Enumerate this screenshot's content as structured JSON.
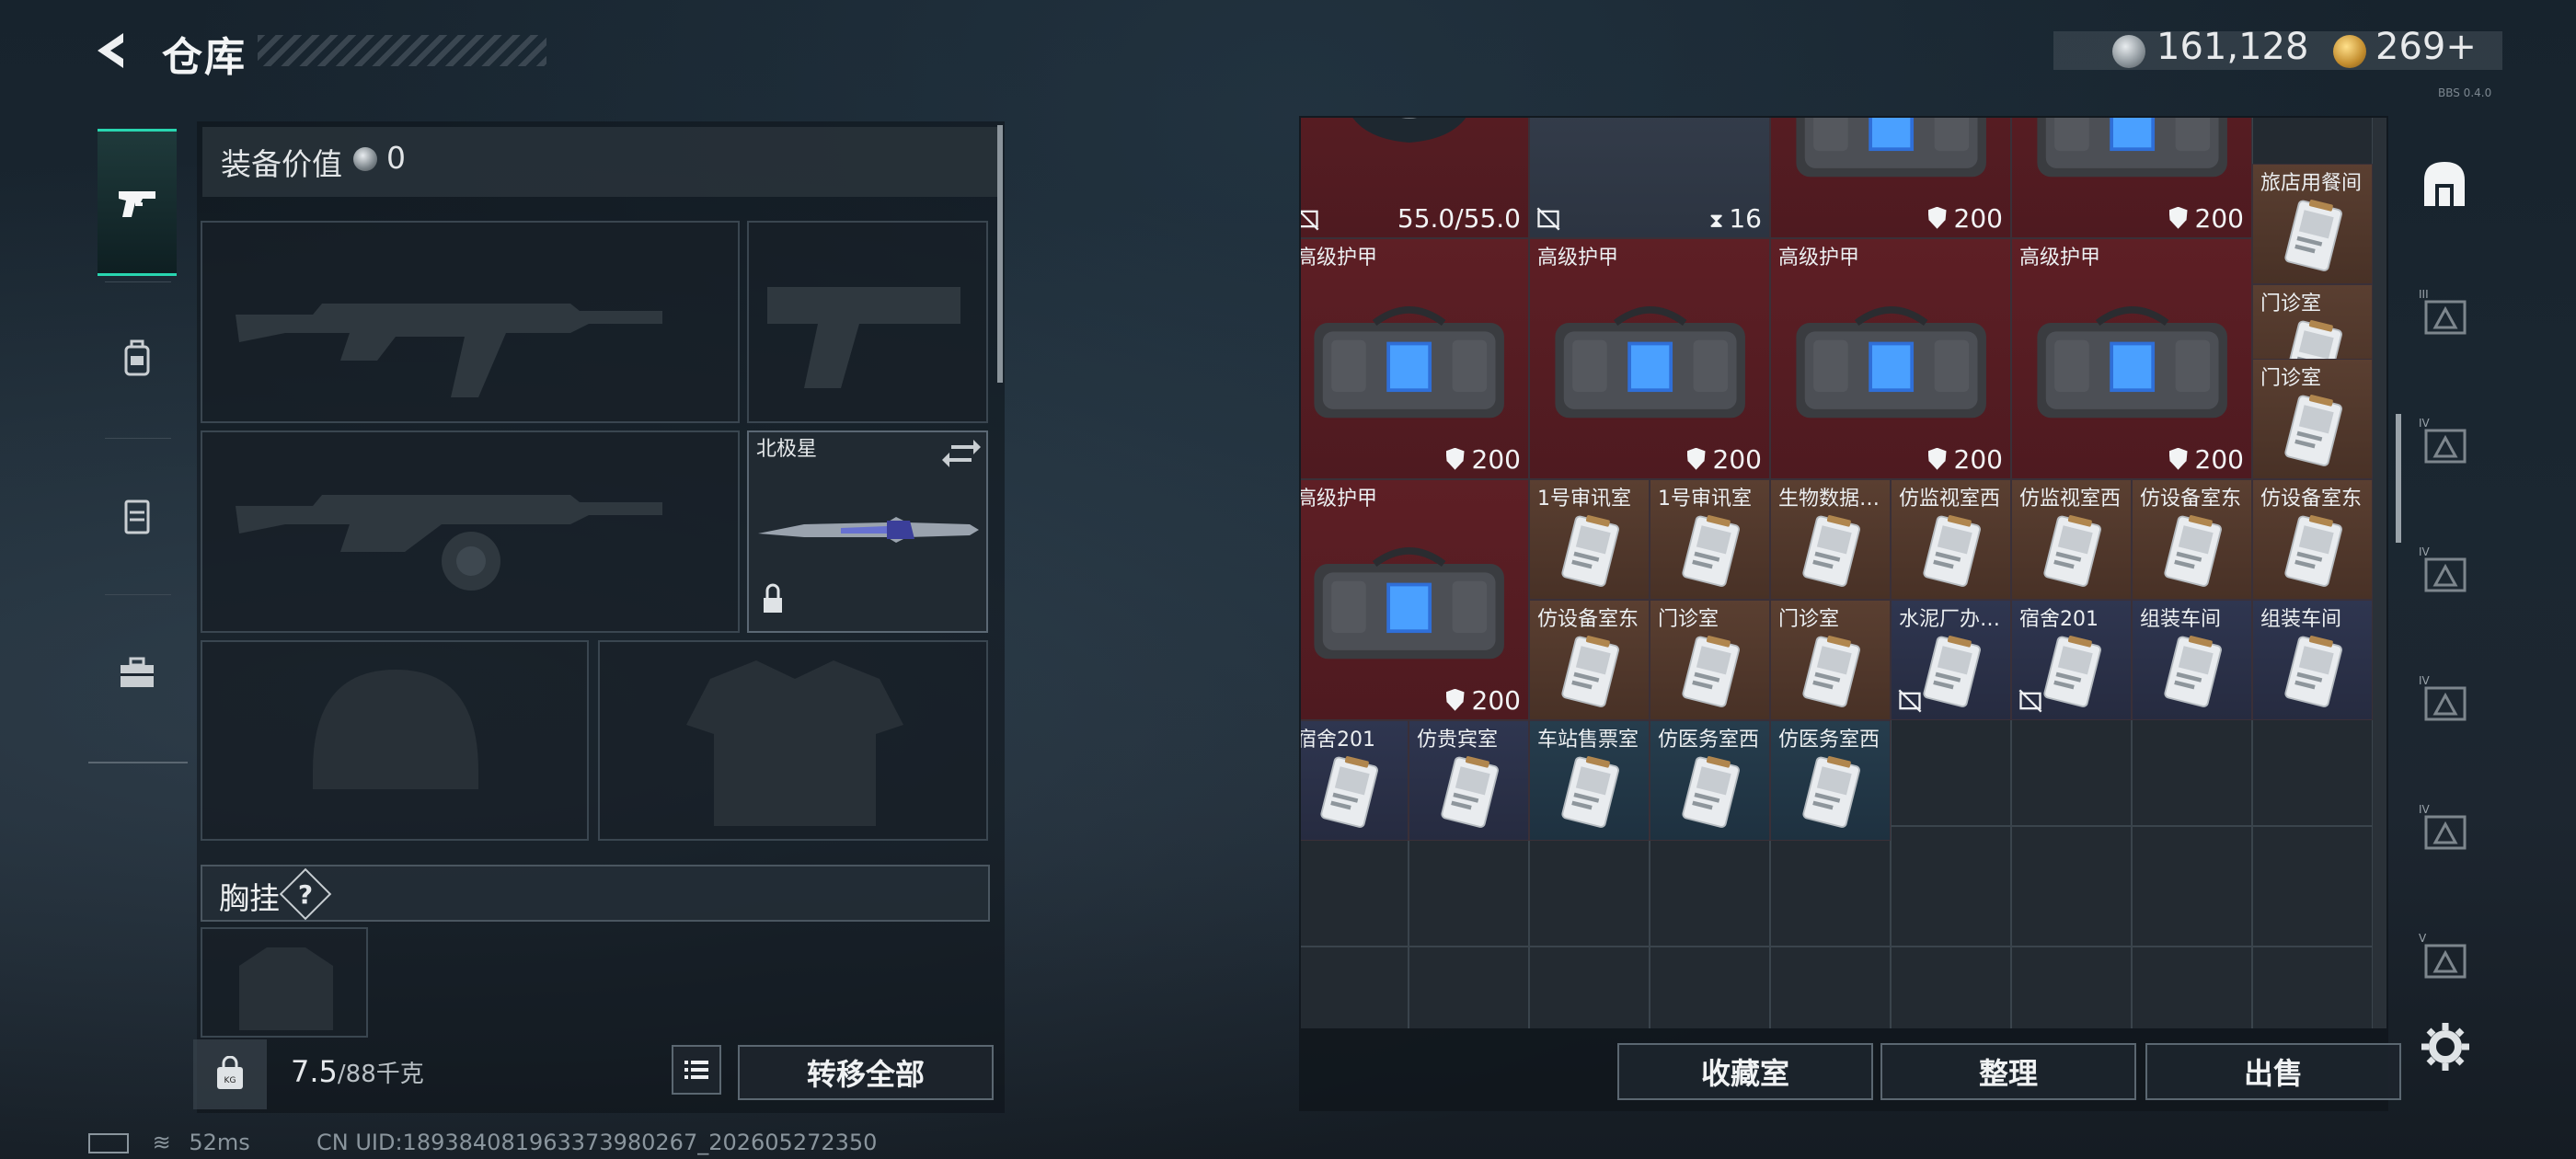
{
  "header": {
    "title": "仓库",
    "currency": {
      "silver": "161,128",
      "gold": "269+"
    },
    "version": "BBS 0.4.0"
  },
  "sidebar": {
    "tabs": [
      "gun-icon",
      "backpack-icon",
      "vest-icon",
      "toolbox-icon"
    ],
    "active": 0,
    "accent": "#28d6b0"
  },
  "loadout": {
    "value_label": "装备价值",
    "value": "0",
    "melee_name": "北极星",
    "rig_label": "胸挂",
    "rig_help": "?",
    "weight_current": "7.5",
    "weight_max": "/88千克",
    "transfer_all": "转移全部"
  },
  "storage": {
    "items": [
      {
        "name": "",
        "value": "55.0/55.0",
        "color": "red",
        "kind": "helmet",
        "noswap": true
      },
      {
        "name": "",
        "value": "16",
        "color": "gray",
        "kind": "pack",
        "noswap": true
      },
      {
        "name": "",
        "value": "200",
        "color": "red",
        "kind": "bag"
      },
      {
        "name": "",
        "value": "200",
        "color": "red",
        "kind": "bag"
      },
      {
        "name": "旅店用餐间",
        "value": "",
        "color": "brown",
        "kind": "card"
      },
      {
        "name": "高级护甲",
        "value": "200",
        "color": "red",
        "kind": "bag"
      },
      {
        "name": "高级护甲",
        "value": "200",
        "color": "red",
        "kind": "bag"
      },
      {
        "name": "高级护甲",
        "value": "200",
        "color": "red",
        "kind": "bag"
      },
      {
        "name": "高级护甲",
        "value": "200",
        "color": "red",
        "kind": "bag"
      },
      {
        "name": "门诊室",
        "value": "",
        "color": "brown",
        "kind": "card",
        "noswap": true
      },
      {
        "name": "门诊室",
        "value": "",
        "color": "brown",
        "kind": "card"
      },
      {
        "name": "高级护甲",
        "value": "200",
        "color": "red",
        "kind": "bag"
      },
      {
        "name": "1号审讯室",
        "value": "",
        "color": "brown",
        "kind": "card"
      },
      {
        "name": "1号审讯室",
        "value": "",
        "color": "brown",
        "kind": "card"
      },
      {
        "name": "生物数据…",
        "value": "",
        "color": "brown",
        "kind": "card"
      },
      {
        "name": "仿监视室西",
        "value": "",
        "color": "brown",
        "kind": "card"
      },
      {
        "name": "仿监视室西",
        "value": "",
        "color": "brown",
        "kind": "card"
      },
      {
        "name": "仿设备室东",
        "value": "",
        "color": "brown",
        "kind": "card"
      },
      {
        "name": "仿设备室东",
        "value": "",
        "color": "brown",
        "kind": "card"
      },
      {
        "name": "仿设备室东",
        "value": "",
        "color": "brown",
        "kind": "card"
      },
      {
        "name": "门诊室",
        "value": "",
        "color": "brown",
        "kind": "card"
      },
      {
        "name": "门诊室",
        "value": "",
        "color": "brown",
        "kind": "card"
      },
      {
        "name": "水泥厂办…",
        "value": "",
        "color": "navy",
        "kind": "card",
        "noswap": true
      },
      {
        "name": "宿舍201",
        "value": "",
        "color": "navy",
        "kind": "card",
        "noswap": true
      },
      {
        "name": "组装车间",
        "value": "",
        "color": "navy",
        "kind": "card"
      },
      {
        "name": "组装车间",
        "value": "",
        "color": "navy",
        "kind": "card"
      },
      {
        "name": "宿舍201",
        "value": "",
        "color": "navy",
        "kind": "card"
      },
      {
        "name": "仿贵宾室",
        "value": "",
        "color": "navy",
        "kind": "card"
      },
      {
        "name": "车站售票室",
        "value": "",
        "color": "teal",
        "kind": "card"
      },
      {
        "name": "仿医务室西",
        "value": "",
        "color": "teal",
        "kind": "card"
      },
      {
        "name": "仿医务室西",
        "value": "",
        "color": "teal",
        "kind": "card"
      }
    ],
    "buttons": {
      "vault": "收藏室",
      "sort": "整理",
      "sell": "出售"
    },
    "categories": [
      "sanctum-icon",
      "tier-III-icon",
      "tier-IV-icon",
      "tier-IV-icon",
      "tier-IV-icon",
      "tier-IV-icon",
      "tier-V-icon"
    ]
  },
  "status": {
    "ping": "52ms",
    "uid": "CN UID:1893840819633739802‌67_202605272350"
  }
}
